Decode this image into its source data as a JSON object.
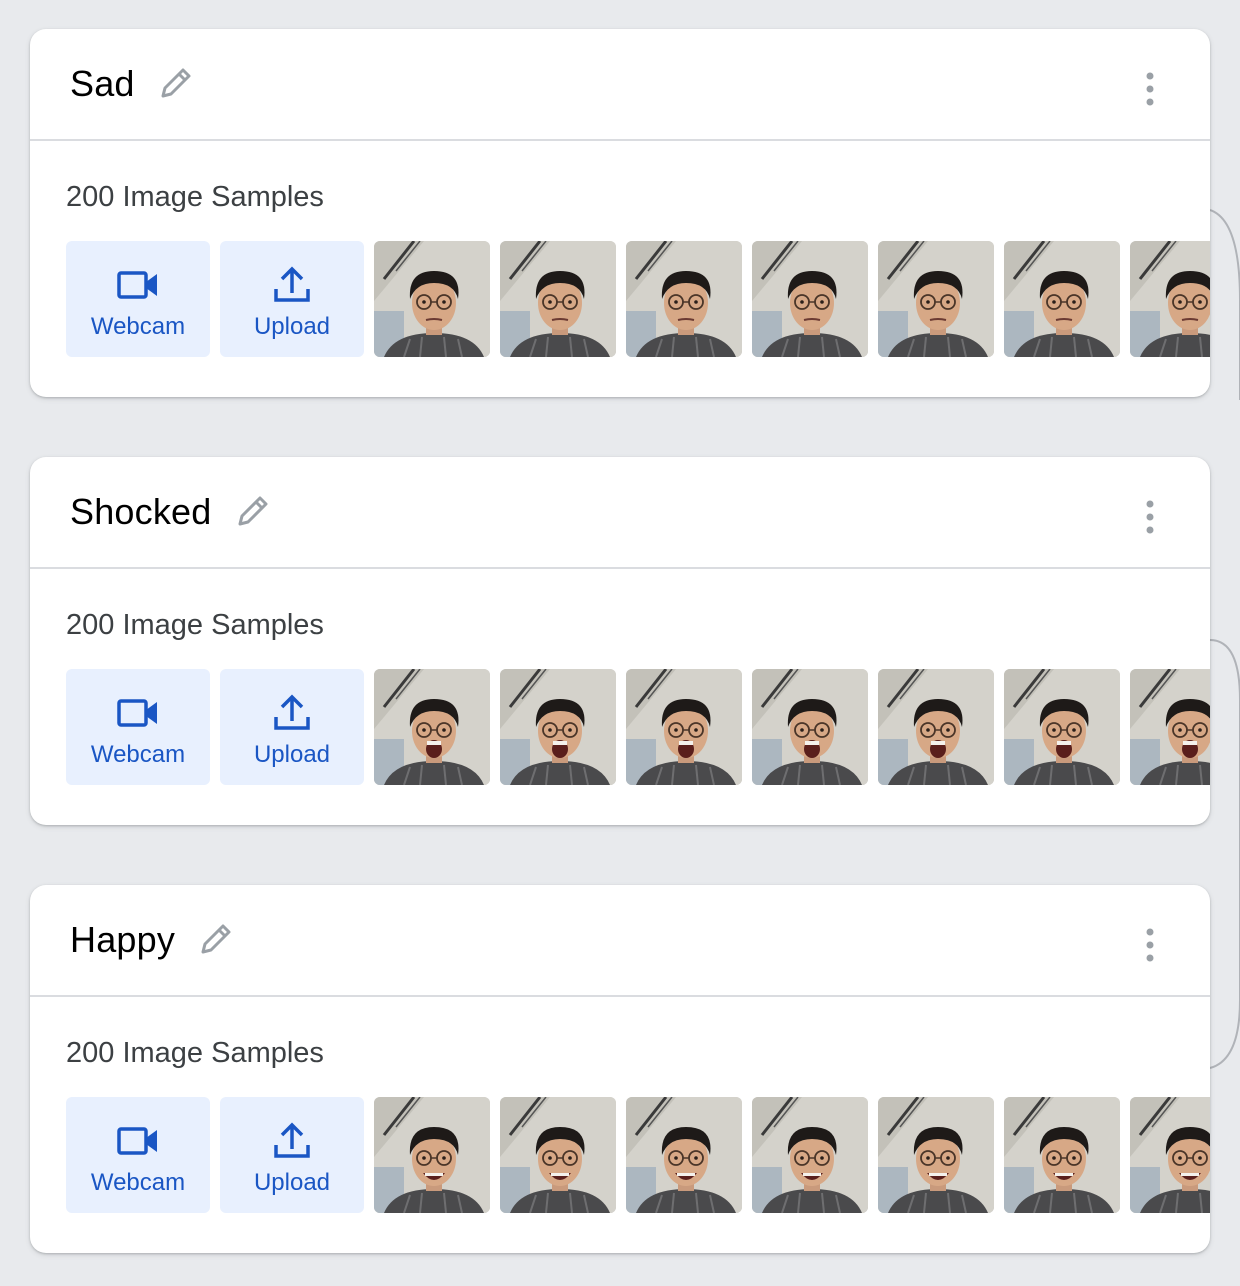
{
  "classes": [
    {
      "name": "Sad",
      "sample_count_label": "200 Image Samples",
      "webcam_label": "Webcam",
      "upload_label": "Upload",
      "expression": "sad",
      "visible_thumbnails": 7
    },
    {
      "name": "Shocked",
      "sample_count_label": "200 Image Samples",
      "webcam_label": "Webcam",
      "upload_label": "Upload",
      "expression": "shocked",
      "visible_thumbnails": 7
    },
    {
      "name": "Happy",
      "sample_count_label": "200 Image Samples",
      "webcam_label": "Webcam",
      "upload_label": "Upload",
      "expression": "happy",
      "visible_thumbnails": 7
    }
  ],
  "icons": {
    "edit": "pencil-icon",
    "more": "more-vert-icon",
    "webcam": "videocam-icon",
    "upload": "upload-icon"
  },
  "colors": {
    "page_background": "#e8eaed",
    "card_background": "#ffffff",
    "button_background": "#e8f0fe",
    "accent": "#1a56c4",
    "icon_gray": "#9aa0a6"
  }
}
